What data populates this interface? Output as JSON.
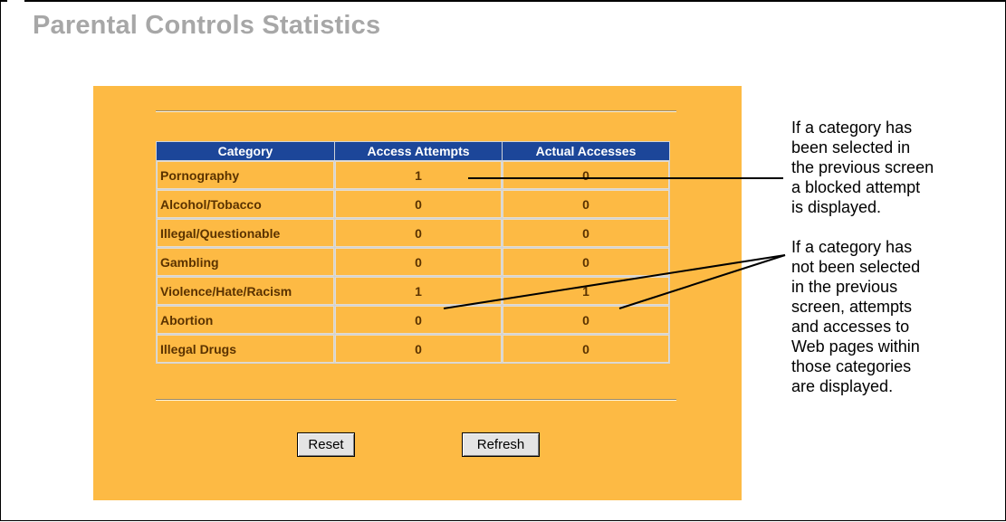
{
  "page": {
    "title": "Parental Controls Statistics"
  },
  "table": {
    "headers": [
      "Category",
      "Access Attempts",
      "Actual Accesses"
    ],
    "rows": [
      {
        "category": "Pornography",
        "attempts": "1",
        "accesses": "0"
      },
      {
        "category": "Alcohol/Tobacco",
        "attempts": "0",
        "accesses": "0"
      },
      {
        "category": "Illegal/Questionable",
        "attempts": "0",
        "accesses": "0"
      },
      {
        "category": "Gambling",
        "attempts": "0",
        "accesses": "0"
      },
      {
        "category": "Violence/Hate/Racism",
        "attempts": "1",
        "accesses": "1"
      },
      {
        "category": "Abortion",
        "attempts": "0",
        "accesses": "0"
      },
      {
        "category": "Illegal Drugs",
        "attempts": "0",
        "accesses": "0"
      }
    ]
  },
  "buttons": {
    "reset": "Reset",
    "refresh": "Refresh"
  },
  "callouts": {
    "selected": "If a category has\nbeen selected in\nthe previous screen\na blocked attempt\nis displayed.",
    "not_selected": "If a category has\nnot been selected\nin the previous\nscreen, attempts\nand accesses to\nWeb pages within\nthose categories\nare displayed."
  },
  "colors": {
    "panel": "#fdba44",
    "header_bg": "#1c4699",
    "title": "#a7a7a7"
  }
}
